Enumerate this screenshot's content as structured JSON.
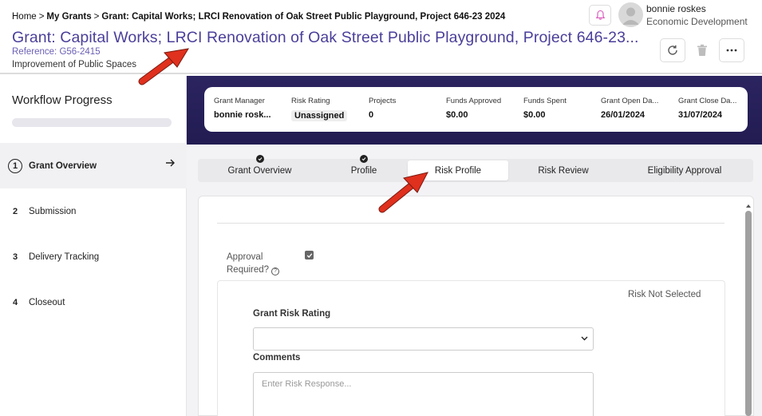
{
  "breadcrumb": {
    "home": "Home",
    "sep": ">",
    "my_grants": "My Grants",
    "current": "Grant: Capital Works; LRCI Renovation of Oak Street Public Playground, Project 646-23 2024"
  },
  "header": {
    "title": "Grant: Capital Works; LRCI Renovation of Oak Street Public Playground, Project 646-23...",
    "reference": "Reference: G56-2415",
    "subtitle": "Improvement of Public Spaces"
  },
  "user": {
    "name": "bonnie roskes",
    "department": "Economic Development"
  },
  "sidebar": {
    "title": "Workflow Progress",
    "progress": 0,
    "steps": [
      {
        "num": "1",
        "label": "Grant Overview"
      },
      {
        "num": "2",
        "label": "Submission"
      },
      {
        "num": "3",
        "label": "Delivery Tracking"
      },
      {
        "num": "4",
        "label": "Closeout"
      }
    ]
  },
  "summary": [
    {
      "label": "Grant Manager",
      "value": "bonnie rosk..."
    },
    {
      "label": "Risk Rating",
      "value": "Unassigned"
    },
    {
      "label": "Projects",
      "value": "0"
    },
    {
      "label": "Funds Approved",
      "value": "$0.00"
    },
    {
      "label": "Funds Spent",
      "value": "$0.00"
    },
    {
      "label": "Grant Open Da...",
      "value": "26/01/2024"
    },
    {
      "label": "Grant Close Da...",
      "value": "31/07/2024"
    }
  ],
  "tabs": [
    {
      "label": "Grant Overview",
      "completed": true
    },
    {
      "label": "Profile",
      "completed": true
    },
    {
      "label": "Risk Profile",
      "completed": false
    },
    {
      "label": "Risk Review",
      "completed": false
    },
    {
      "label": "Eligibility Approval",
      "completed": false
    }
  ],
  "active_tab": "Risk Profile",
  "form": {
    "approval_label_1": "Approval",
    "approval_label_2": "Required?",
    "approval_checked": true,
    "risk_status": "Risk Not Selected",
    "risk_rating_label": "Grant Risk Rating",
    "risk_rating_value": "",
    "comments_label": "Comments",
    "comments_placeholder": "Enter Risk Response..."
  },
  "colors": {
    "title": "#4a3f9a",
    "band": "#2b2460",
    "arrow": "#e0301e"
  }
}
